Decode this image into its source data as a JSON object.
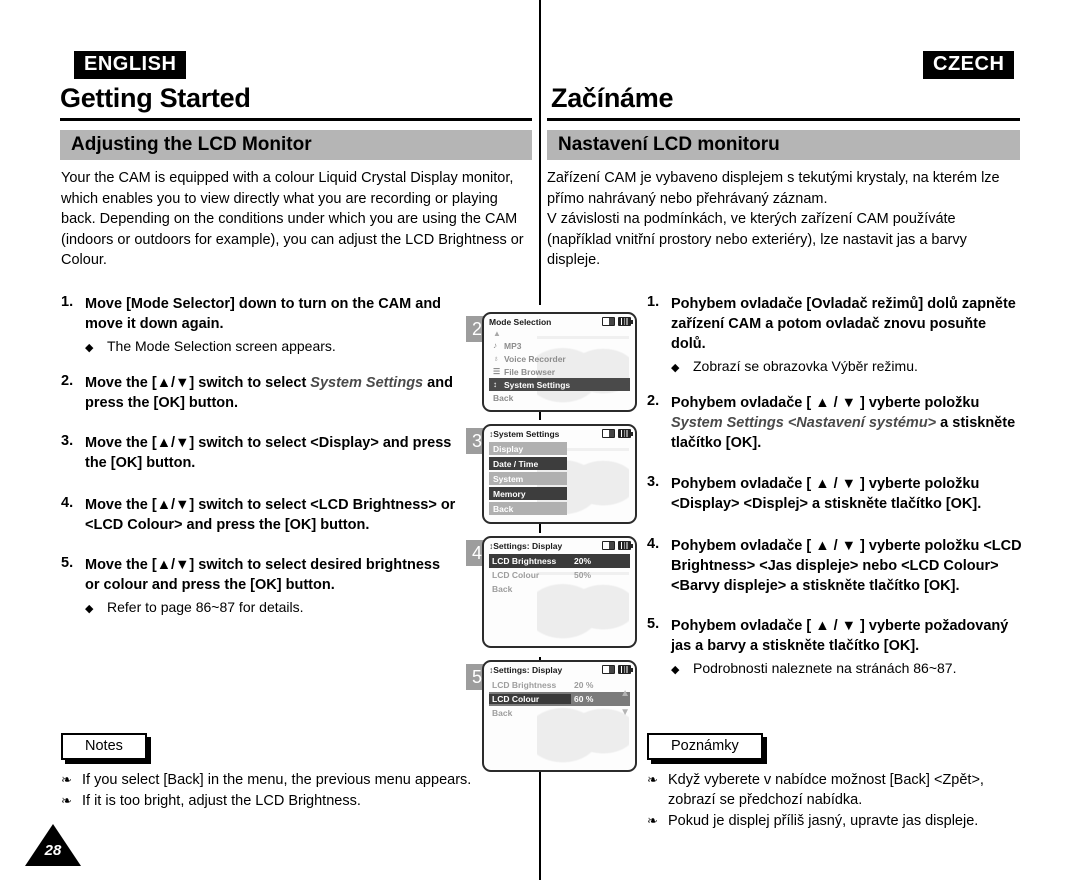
{
  "left": {
    "language_tag": "ENGLISH",
    "chapter_title": "Getting Started",
    "section_title": "Adjusting the LCD Monitor",
    "intro": "Your the CAM is equipped with a colour Liquid Crystal Display monitor, which enables you to view directly what you are recording or playing back. Depending on the conditions under which you are using the CAM (indoors or outdoors for example), you can adjust the LCD Brightness or Colour.",
    "steps": [
      {
        "num": "1.",
        "text": "Move [Mode Selector] down to turn on the CAM and move it down again.",
        "sub": "The Mode Selection screen appears."
      },
      {
        "num": "2.",
        "text_before": "Move the [▲/▼] switch to select ",
        "italic": "System Settings",
        "text_after": " and press the [OK] button.",
        "sub": ""
      },
      {
        "num": "3.",
        "text": "Move the [▲/▼] switch to select <Display> and press the [OK] button.",
        "sub": ""
      },
      {
        "num": "4.",
        "text": "Move the [▲/▼] switch to select <LCD Brightness> or <LCD Colour> and press the [OK] button.",
        "sub": ""
      },
      {
        "num": "5.",
        "text": "Move the [▲/▼] switch to select desired brightness or colour and press the [OK] button.",
        "sub": "Refer to page 86~87 for details."
      }
    ],
    "notes_label": "Notes",
    "notes": [
      "If you select [Back] in the menu, the previous menu appears.",
      "If it is too bright, adjust the LCD Brightness."
    ]
  },
  "right": {
    "language_tag": "CZECH",
    "chapter_title": "Začínáme",
    "section_title": "Nastavení LCD monitoru",
    "intro": "Zařízení CAM je vybaveno displejem s tekutými krystaly, na kterém lze přímo nahrávaný nebo přehrávaný záznam.\nV závislosti na podmínkách, ve kterých zařízení CAM používáte (například vnitřní prostory nebo exteriéry), lze nastavit jas a barvy displeje.",
    "steps": [
      {
        "num": "1.",
        "text": "Pohybem ovladače [Ovladač režimů] dolů zapněte zařízení CAM a potom ovladač znovu posuňte dolů.",
        "sub": "Zobrazí se obrazovka Výběr režimu."
      },
      {
        "num": "2.",
        "text_before": "Pohybem ovladače [ ▲ / ▼ ] vyberte položku ",
        "italic": "System Settings <Nastavení systému>",
        "text_after": " a stiskněte tlačítko [OK].",
        "sub": ""
      },
      {
        "num": "3.",
        "text": "Pohybem ovladače [ ▲ / ▼ ] vyberte položku <Display> <Displej> a stiskněte tlačítko [OK].",
        "sub": ""
      },
      {
        "num": "4.",
        "text": "Pohybem ovladače [ ▲ / ▼ ] vyberte položku <LCD Brightness> <Jas displeje> nebo <LCD Colour> <Barvy displeje> a stiskněte tlačítko [OK].",
        "sub": ""
      },
      {
        "num": "5.",
        "text": "Pohybem ovladače [ ▲ / ▼ ] vyberte požadovaný jas a barvy a stiskněte tlačítko [OK].",
        "sub": "Podrobnosti naleznete na stránách 86~87."
      }
    ],
    "notes_label": "Poznámky",
    "notes": [
      "Když vyberete v nabídce možnost [Back] <Zpět>, zobrazí se předchozí nabídka.",
      "Pokud je displej příliš jasný, upravte jas displeje."
    ]
  },
  "lcd_screens": [
    {
      "step_badge": "2",
      "header": "Mode Selection",
      "header_icon": "",
      "rows": [
        {
          "icon": "♪",
          "label": "MP3",
          "state": "plain"
        },
        {
          "icon": "♁",
          "label": "Voice Recorder",
          "state": "plain"
        },
        {
          "icon": "☰",
          "label": "File Browser",
          "state": "plain"
        },
        {
          "icon": "↕",
          "label": "System Settings",
          "state": "sel"
        },
        {
          "icon": "",
          "label": "Back",
          "state": "back"
        }
      ]
    },
    {
      "step_badge": "3",
      "header": "System Settings",
      "header_icon": "↕",
      "rows": [
        {
          "icon": "",
          "label": "Display",
          "state": "gray"
        },
        {
          "icon": "",
          "label": "Date / Time",
          "state": "dark"
        },
        {
          "icon": "",
          "label": "System",
          "state": "gray"
        },
        {
          "icon": "",
          "label": "Memory",
          "state": "dark"
        },
        {
          "icon": "",
          "label": "Back",
          "state": "gray"
        }
      ]
    },
    {
      "step_badge": "4",
      "header": "Settings: Display",
      "header_icon": "↕",
      "kv_rows": [
        {
          "key": "LCD Brightness",
          "value": "20%",
          "state": "dark-all"
        },
        {
          "key": "LCD Colour",
          "value": "50%",
          "state": "gray"
        },
        {
          "key": "Back",
          "value": "",
          "state": "gray"
        }
      ]
    },
    {
      "step_badge": "5",
      "header": "Settings: Display",
      "header_icon": "↕",
      "kv_rows": [
        {
          "key": "LCD Brightness",
          "value": "20 %",
          "state": "gray"
        },
        {
          "key": "LCD Colour",
          "value": "60 %",
          "state": "row5-sel"
        },
        {
          "key": "Back",
          "value": "",
          "state": "gray"
        }
      ],
      "arrow_up": "▲",
      "arrow_down": "▼"
    }
  ],
  "page_number": "28",
  "colors": {
    "section_bar": "#b5b5b5",
    "badge": "#9d9d9d",
    "lcd_selected": "#4a4a4a",
    "lcd_gray": "#b0b0b0"
  }
}
